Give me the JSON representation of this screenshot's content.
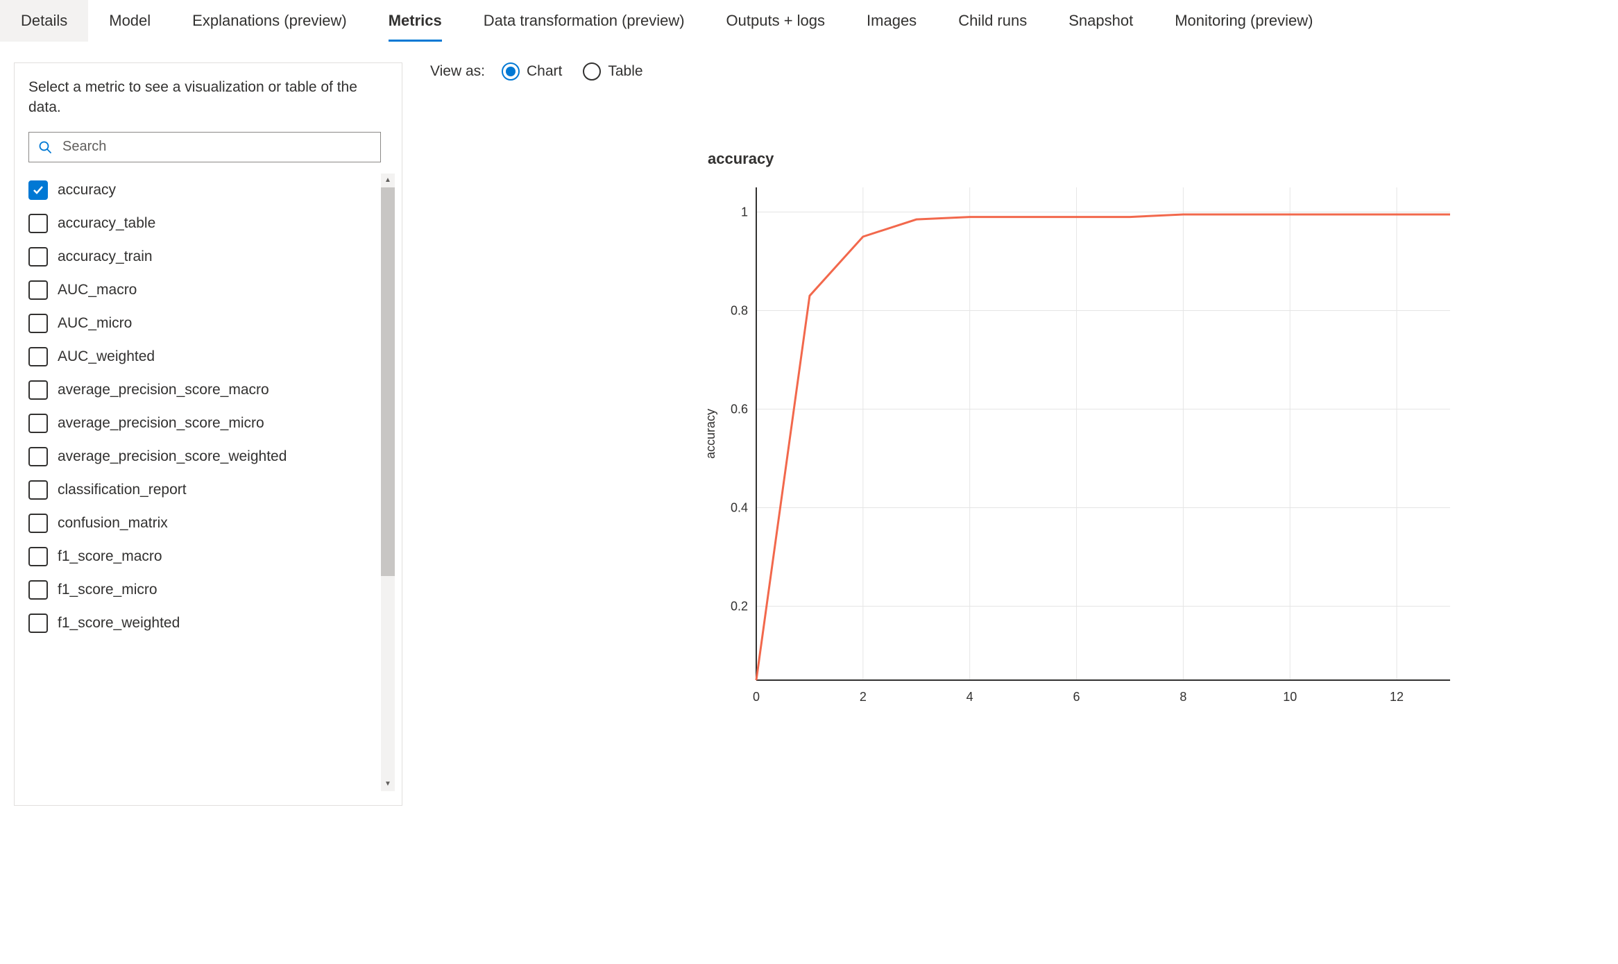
{
  "tabs": [
    {
      "label": "Details",
      "selected": false,
      "active_bg": true
    },
    {
      "label": "Model",
      "selected": false,
      "active_bg": false
    },
    {
      "label": "Explanations (preview)",
      "selected": false,
      "active_bg": false
    },
    {
      "label": "Metrics",
      "selected": true,
      "active_bg": false
    },
    {
      "label": "Data transformation (preview)",
      "selected": false,
      "active_bg": false
    },
    {
      "label": "Outputs + logs",
      "selected": false,
      "active_bg": false
    },
    {
      "label": "Images",
      "selected": false,
      "active_bg": false
    },
    {
      "label": "Child runs",
      "selected": false,
      "active_bg": false
    },
    {
      "label": "Snapshot",
      "selected": false,
      "active_bg": false
    },
    {
      "label": "Monitoring (preview)",
      "selected": false,
      "active_bg": false
    }
  ],
  "panel": {
    "description": "Select a metric to see a visualization or table of the data.",
    "search_placeholder": "Search"
  },
  "metrics": [
    {
      "label": "accuracy",
      "checked": true
    },
    {
      "label": "accuracy_table",
      "checked": false
    },
    {
      "label": "accuracy_train",
      "checked": false
    },
    {
      "label": "AUC_macro",
      "checked": false
    },
    {
      "label": "AUC_micro",
      "checked": false
    },
    {
      "label": "AUC_weighted",
      "checked": false
    },
    {
      "label": "average_precision_score_macro",
      "checked": false
    },
    {
      "label": "average_precision_score_micro",
      "checked": false
    },
    {
      "label": "average_precision_score_weighted",
      "checked": false
    },
    {
      "label": "classification_report",
      "checked": false
    },
    {
      "label": "confusion_matrix",
      "checked": false
    },
    {
      "label": "f1_score_macro",
      "checked": false
    },
    {
      "label": "f1_score_micro",
      "checked": false
    },
    {
      "label": "f1_score_weighted",
      "checked": false
    }
  ],
  "viewas": {
    "label": "View as:",
    "options": [
      {
        "label": "Chart",
        "selected": true
      },
      {
        "label": "Table",
        "selected": false
      }
    ]
  },
  "chart_data": {
    "type": "line",
    "title": "accuracy",
    "xlabel": "",
    "ylabel": "accuracy",
    "xlim": [
      0,
      13
    ],
    "ylim": [
      0.05,
      1.05
    ],
    "x_ticks": [
      0,
      2,
      4,
      6,
      8,
      10,
      12
    ],
    "y_ticks": [
      0.2,
      0.4,
      0.6,
      0.8,
      1
    ],
    "series": [
      {
        "name": "accuracy",
        "color": "#f2684c",
        "x": [
          0,
          1,
          2,
          3,
          4,
          5,
          6,
          7,
          8,
          9,
          10,
          11,
          12,
          13
        ],
        "y": [
          0.05,
          0.83,
          0.95,
          0.985,
          0.99,
          0.99,
          0.99,
          0.99,
          0.995,
          0.995,
          0.995,
          0.995,
          0.995,
          0.995
        ]
      }
    ]
  }
}
